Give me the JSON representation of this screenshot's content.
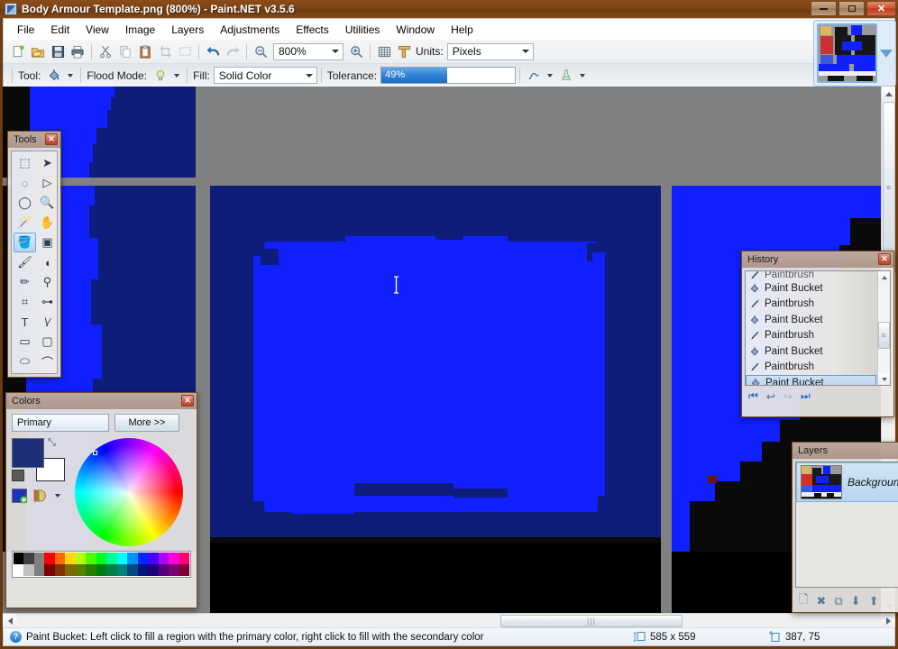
{
  "window": {
    "title": "Body Armour Template.png (800%) - Paint.NET v3.5.6",
    "app_icon": "paintdotnet-icon",
    "controls": {
      "minimize": "minimize-button",
      "maximize": "maximize-button",
      "close": "✕"
    }
  },
  "menu": {
    "items": [
      {
        "label": "File"
      },
      {
        "label": "Edit"
      },
      {
        "label": "View"
      },
      {
        "label": "Image"
      },
      {
        "label": "Layers"
      },
      {
        "label": "Adjustments"
      },
      {
        "label": "Effects"
      },
      {
        "label": "Utilities"
      },
      {
        "label": "Window"
      },
      {
        "label": "Help"
      }
    ]
  },
  "toolbar": {
    "main_icons": [
      {
        "name": "new-icon",
        "glyph": "🗋"
      },
      {
        "name": "open-icon",
        "glyph": "📂"
      },
      {
        "name": "save-icon",
        "glyph": "💾"
      },
      {
        "name": "print-icon",
        "glyph": "🖶"
      },
      {
        "name": "cut-icon",
        "glyph": "✂"
      },
      {
        "name": "copy-icon",
        "glyph": "⧉"
      },
      {
        "name": "paste-icon",
        "glyph": "📋"
      },
      {
        "name": "crop-icon",
        "glyph": "⛶"
      },
      {
        "name": "deselect-icon",
        "glyph": "▧"
      },
      {
        "name": "undo-icon",
        "glyph": "↩"
      },
      {
        "name": "redo-icon",
        "glyph": "↪"
      },
      {
        "name": "zoom-out-icon",
        "glyph": "⊖"
      },
      {
        "name": "zoom-in-icon",
        "glyph": "⊕"
      },
      {
        "name": "grid-icon",
        "glyph": "▦"
      },
      {
        "name": "rulers-icon",
        "glyph": "⊢"
      }
    ],
    "zoom": {
      "label": "",
      "value": "800%"
    },
    "units": {
      "label": "Units:",
      "value": "Pixels"
    },
    "tool": {
      "label": "Tool:",
      "icon": "paint-bucket-icon"
    },
    "flood_mode": {
      "label": "Flood Mode:",
      "icon": "flood-mode-icon"
    },
    "fill": {
      "label": "Fill:",
      "value": "Solid Color"
    },
    "tolerance": {
      "label": "Tolerance:",
      "value": "49%",
      "percent": 49
    },
    "antialiasing": {
      "icon": "antialias-icon"
    },
    "blend_mode": {
      "icon": "blend-mode-icon"
    }
  },
  "tools_palette": {
    "title": "Tools",
    "close": "✕",
    "selected": "paint-bucket",
    "tools": [
      {
        "name": "rectangle-select-tool",
        "glyph": "⬚"
      },
      {
        "name": "move-selected-tool",
        "glyph": "➤"
      },
      {
        "name": "lasso-select-tool",
        "glyph": "◌"
      },
      {
        "name": "move-selection-tool",
        "glyph": "▷"
      },
      {
        "name": "ellipse-select-tool",
        "glyph": "◯"
      },
      {
        "name": "zoom-tool",
        "glyph": "🔍"
      },
      {
        "name": "magic-wand-tool",
        "glyph": "🪄"
      },
      {
        "name": "pan-tool",
        "glyph": "✋"
      },
      {
        "name": "paint-bucket-tool",
        "glyph": "🪣"
      },
      {
        "name": "gradient-tool",
        "glyph": "▣"
      },
      {
        "name": "paintbrush-tool",
        "glyph": "🖌"
      },
      {
        "name": "eraser-tool",
        "glyph": "◖"
      },
      {
        "name": "pencil-tool",
        "glyph": "✏"
      },
      {
        "name": "color-picker-tool",
        "glyph": "⚲"
      },
      {
        "name": "clone-stamp-tool",
        "glyph": "⌗"
      },
      {
        "name": "recolor-tool",
        "glyph": "⊶"
      },
      {
        "name": "text-tool",
        "glyph": "T"
      },
      {
        "name": "line-curve-tool",
        "glyph": "\\⁄"
      },
      {
        "name": "rectangle-tool",
        "glyph": "▭"
      },
      {
        "name": "rounded-rect-tool",
        "glyph": "▢"
      },
      {
        "name": "ellipse-tool",
        "glyph": "⬭"
      },
      {
        "name": "freeform-shape-tool",
        "glyph": "⌒"
      }
    ]
  },
  "colors_palette": {
    "title": "Colors",
    "close": "✕",
    "mode_select": "Primary",
    "more_button": "More >>",
    "primary_color": "#1c2f78",
    "secondary_color": "#ffffff",
    "swap_icon": "swap-colors-icon",
    "add_color_icon": "add-color-icon",
    "palette_icon": "palette-icon",
    "palette_row_1": [
      "#000000",
      "#404040",
      "#808080",
      "#ff0000",
      "#ff6a00",
      "#ffd800",
      "#b6ff00",
      "#4cff00",
      "#00ff21",
      "#00ff90",
      "#00ffff",
      "#0094ff",
      "#0026ff",
      "#4800ff",
      "#b200ff",
      "#ff00dc",
      "#ff006e"
    ],
    "palette_row_2": [
      "#ffffff",
      "#c0c0c0",
      "#7f7f7f",
      "#7f0000",
      "#7f3300",
      "#7f6a00",
      "#5b7f00",
      "#267f00",
      "#007f0e",
      "#007f46",
      "#007f7f",
      "#004a7f",
      "#00137f",
      "#21007f",
      "#57007f",
      "#7f006e",
      "#7f0037"
    ]
  },
  "history_palette": {
    "title": "History",
    "close": "✕",
    "items": [
      {
        "label": "Paintbrush",
        "icon": "paintbrush-icon",
        "selected": false,
        "partial": true
      },
      {
        "label": "Paint Bucket",
        "icon": "paint-bucket-icon",
        "selected": false,
        "partial": false
      },
      {
        "label": "Paintbrush",
        "icon": "paintbrush-icon",
        "selected": false,
        "partial": false
      },
      {
        "label": "Paint Bucket",
        "icon": "paint-bucket-icon",
        "selected": false,
        "partial": false
      },
      {
        "label": "Paintbrush",
        "icon": "paintbrush-icon",
        "selected": false,
        "partial": false
      },
      {
        "label": "Paint Bucket",
        "icon": "paint-bucket-icon",
        "selected": false,
        "partial": false
      },
      {
        "label": "Paintbrush",
        "icon": "paintbrush-icon",
        "selected": false,
        "partial": false
      },
      {
        "label": "Paint Bucket",
        "icon": "paint-bucket-icon",
        "selected": true,
        "partial": false
      }
    ],
    "nav": [
      {
        "name": "rewind-all-button",
        "glyph": "⏮"
      },
      {
        "name": "undo-button",
        "glyph": "↩"
      },
      {
        "name": "redo-button",
        "glyph": "↪"
      },
      {
        "name": "forward-all-button",
        "glyph": "⏭"
      }
    ]
  },
  "layers_palette": {
    "title": "Layers",
    "items": [
      {
        "name": "Background",
        "selected": true
      }
    ],
    "nav": [
      {
        "name": "add-layer-button",
        "glyph": "🗋"
      },
      {
        "name": "delete-layer-button",
        "glyph": "✖"
      },
      {
        "name": "duplicate-layer-button",
        "glyph": "⧉"
      },
      {
        "name": "merge-layer-down-button",
        "glyph": "⬇"
      },
      {
        "name": "move-layer-up-button",
        "glyph": "⬆"
      }
    ]
  },
  "thumbnail_dock": {
    "name": "image-thumbnail",
    "arrow": "chevron-down-icon"
  },
  "status_bar": {
    "help_icon": "?",
    "hint": "Paint Bucket: Left click to fill a region with the primary color, right click to fill with the secondary color",
    "size_icon": "image-size-icon",
    "image_size": "585 x 559",
    "cursor_icon": "cursor-position-icon",
    "cursor_position": "387, 75"
  },
  "canvas": {
    "background": "#808080",
    "zoom": "800%",
    "cursor": "text-caret-cursor",
    "colors": {
      "dark_navy": "#0e1d7a",
      "bright_blue": "#1020ff",
      "near_black": "#0a0a0a",
      "black": "#000000"
    }
  }
}
